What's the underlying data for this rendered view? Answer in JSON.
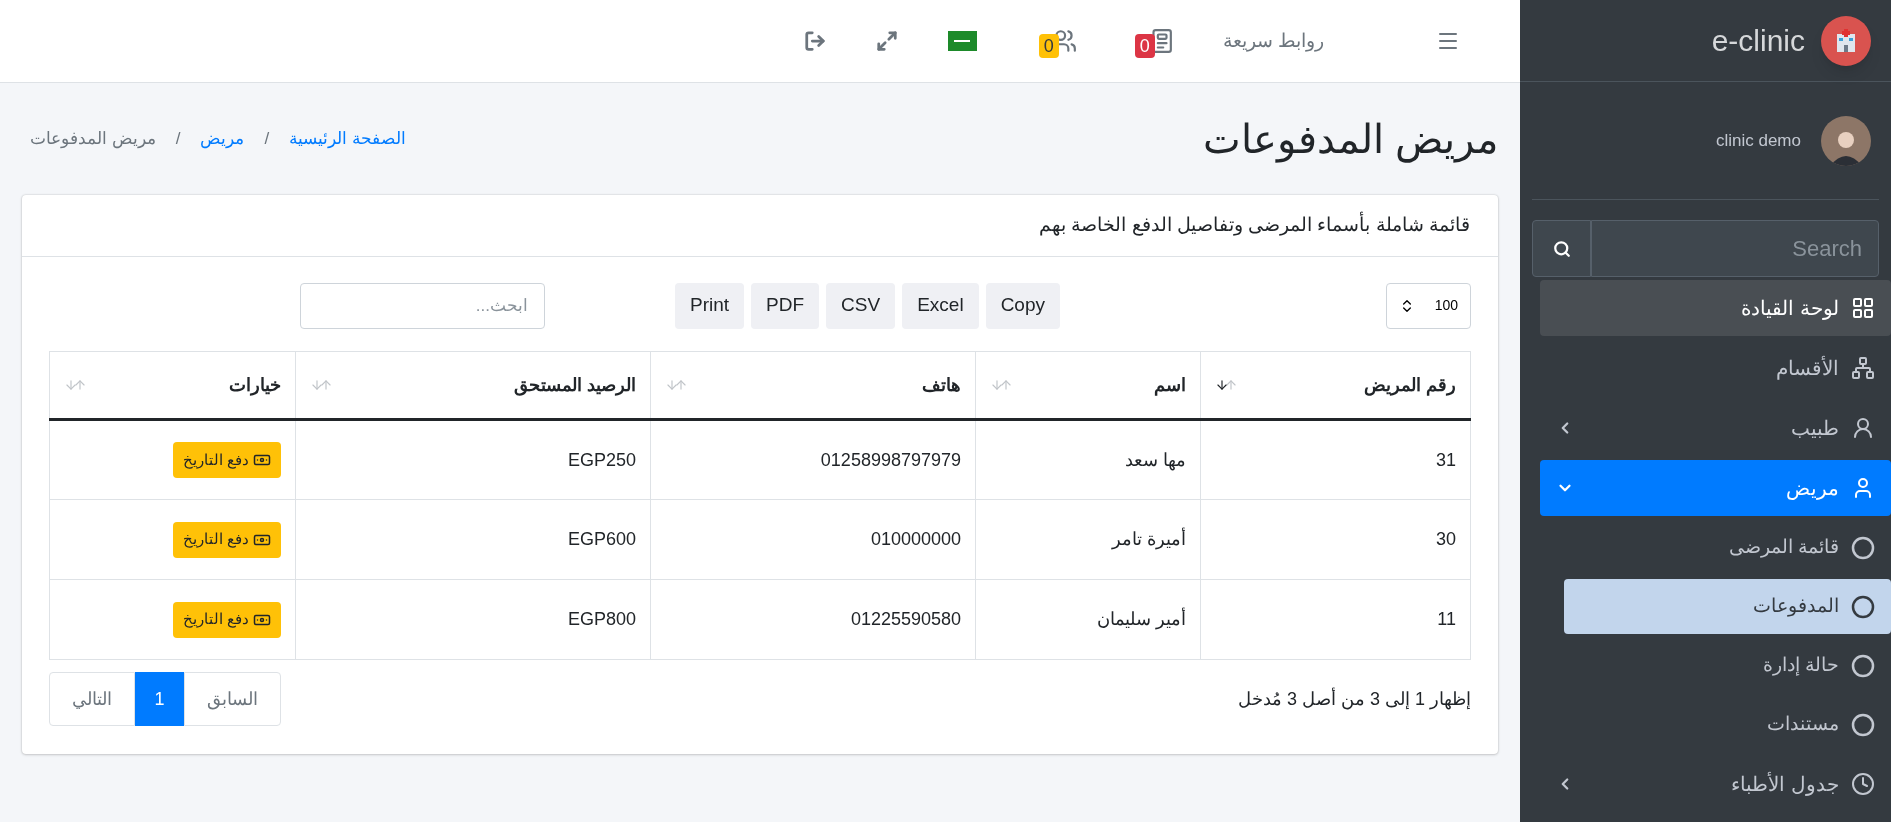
{
  "topbar": {
    "quick_links": "روابط سريعة",
    "messages_badge": "0",
    "users_badge": "0"
  },
  "sidebar": {
    "brand": "e-clinic",
    "user": "clinic demo",
    "search": {
      "placeholder": "Search"
    },
    "items": [
      {
        "label": "لوحة القيادة",
        "kind": "link",
        "selected": false,
        "highlighted": true
      },
      {
        "label": "الأقسام",
        "kind": "link",
        "selected": false,
        "highlighted": false
      },
      {
        "label": "طبيب",
        "kind": "menu",
        "selected": false,
        "highlighted": false,
        "expanded": false
      },
      {
        "label": "مريض",
        "kind": "menu",
        "selected": true,
        "highlighted": false,
        "expanded": true,
        "children": [
          {
            "label": "قائمة المرضى",
            "selected": false
          },
          {
            "label": "المدفوعات",
            "selected": true
          },
          {
            "label": "حالة إدارة",
            "selected": false
          },
          {
            "label": "مستندات",
            "selected": false
          }
        ]
      },
      {
        "label": "جدول الأطباء",
        "kind": "menu",
        "selected": false,
        "highlighted": false,
        "expanded": false
      }
    ]
  },
  "page_title": "مريض المدفوعات",
  "breadcrumbs": [
    {
      "label": "الصفحة الرئيسية",
      "kind": "link"
    },
    {
      "label": "/",
      "kind": "separator"
    },
    {
      "label": "مريض",
      "kind": "link"
    },
    {
      "label": "/",
      "kind": "separator"
    },
    {
      "label": "مريض المدفوعات",
      "kind": "current"
    }
  ],
  "card": {
    "header": "قائمة شاملة بأسماء المرضى وتفاصيل الدفع الخاصة بهم",
    "page_length": "100",
    "export_buttons": [
      "Copy",
      "Excel",
      "CSV",
      "PDF",
      "Print"
    ],
    "search": {
      "placeholder": "ابحث..."
    },
    "table": {
      "columns": [
        {
          "label": "رقم المريض",
          "sorted": true
        },
        {
          "label": "اسم",
          "sorted": false
        },
        {
          "label": "هاتف",
          "sorted": false
        },
        {
          "label": "الرصيد المستحق",
          "sorted": false
        },
        {
          "label": "خيارات",
          "sorted": false
        }
      ],
      "rows": [
        {
          "id": "31",
          "name": "مها سعد",
          "phone": "01258998797979",
          "balance": "EGP250",
          "action": "دفع التاريخ"
        },
        {
          "id": "30",
          "name": "أميرة تامر",
          "phone": "010000000",
          "balance": "EGP600",
          "action": "دفع التاريخ"
        },
        {
          "id": "11",
          "name": "أمير سليمان",
          "phone": "01225590580",
          "balance": "EGP800",
          "action": "دفع التاريخ"
        }
      ]
    },
    "info": "إظهار 1 إلى 3 من أصل 3 مُدخل",
    "pagination": {
      "previous": "السابق",
      "pages": [
        {
          "label": "1",
          "selected": true
        }
      ],
      "next": "التالي"
    }
  }
}
